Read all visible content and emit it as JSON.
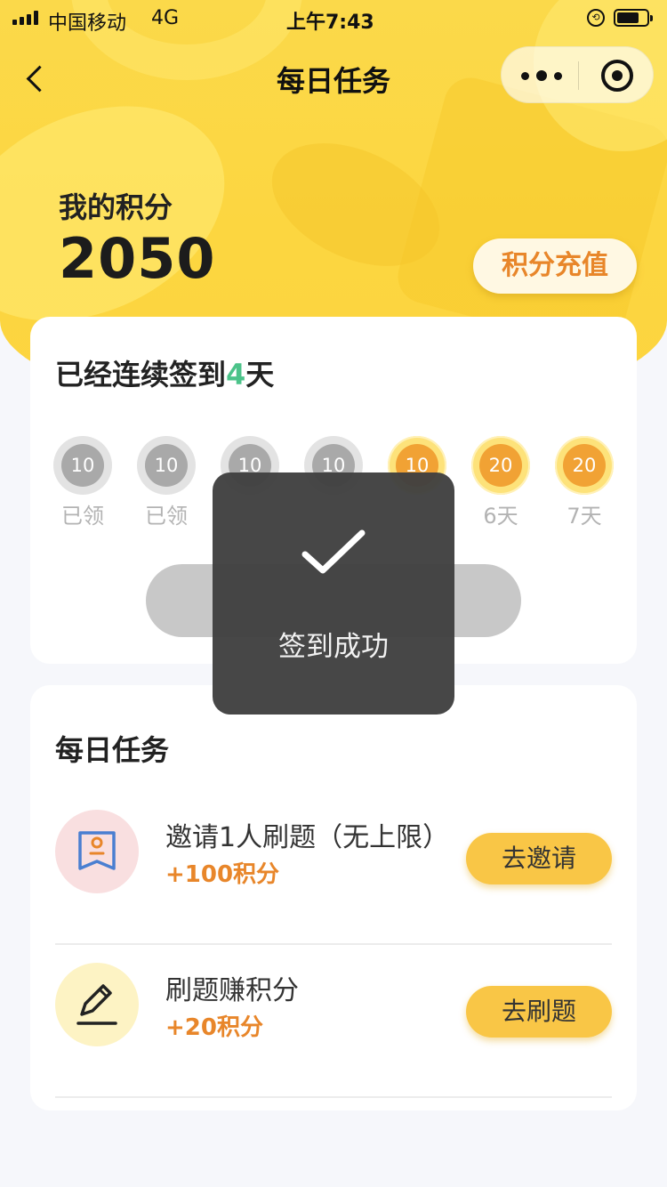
{
  "status_bar": {
    "carrier": "中国移动",
    "network": "4G",
    "time": "上午7:43"
  },
  "nav": {
    "title": "每日任务"
  },
  "points": {
    "label": "我的积分",
    "value": "2050",
    "recharge_label": "积分充值"
  },
  "signin": {
    "title_prefix": "已经连续签到",
    "days_count": "4",
    "title_suffix": "天",
    "days": [
      {
        "points": "10",
        "label": "已领",
        "state": "claimed"
      },
      {
        "points": "10",
        "label": "已领",
        "state": "claimed"
      },
      {
        "points": "10",
        "label": "",
        "state": "claimed"
      },
      {
        "points": "10",
        "label": "",
        "state": "claimed"
      },
      {
        "points": "10",
        "label": "",
        "state": "today"
      },
      {
        "points": "20",
        "label": "6天",
        "state": "pending"
      },
      {
        "points": "20",
        "label": "7天",
        "state": "pending"
      }
    ]
  },
  "tasks": {
    "title": "每日任务",
    "items": [
      {
        "name": "邀请1人刷题（无上限）",
        "reward": "+100积分",
        "action": "去邀请",
        "icon": "invite-card-icon"
      },
      {
        "name": "刷题赚积分",
        "reward": "+20积分",
        "action": "去刷题",
        "icon": "pencil-icon"
      }
    ]
  },
  "toast": {
    "text": "签到成功",
    "icon": "checkmark-icon"
  },
  "colors": {
    "accent": "#f9c646",
    "orange": "#e8862a",
    "green": "#4cc38a",
    "toast_bg": "#404040"
  }
}
